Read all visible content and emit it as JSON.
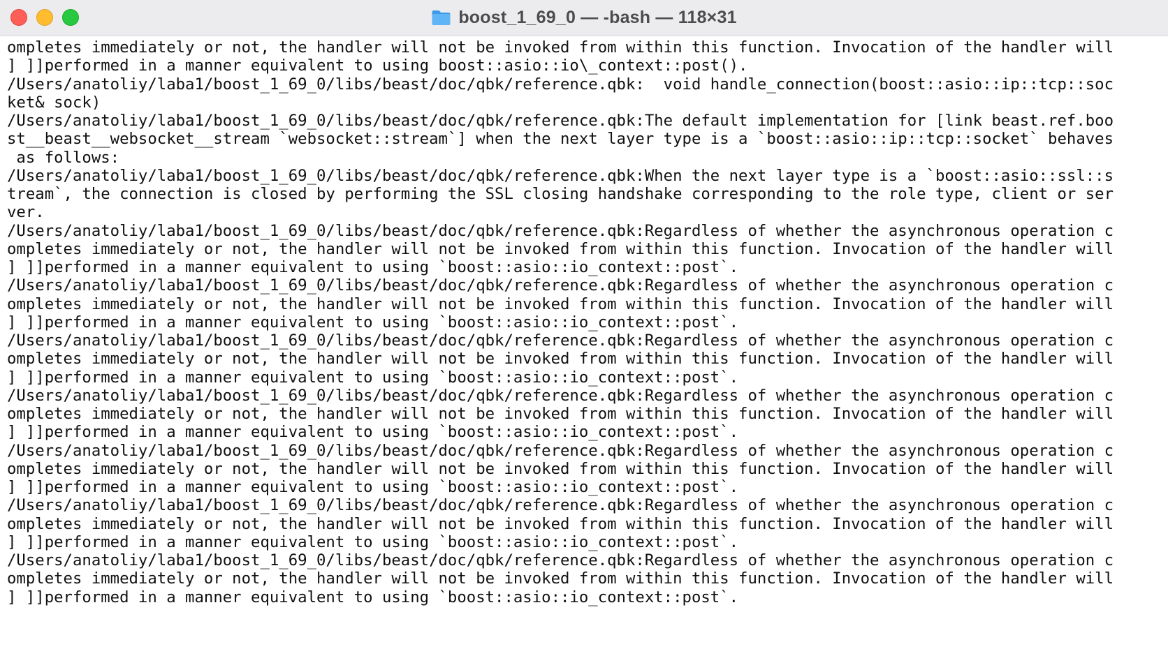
{
  "window": {
    "title": "boost_1_69_0 — -bash — 118×31",
    "folder_icon": "folder-icon",
    "colors": {
      "close": "#ff5f57",
      "minimize": "#febc2e",
      "zoom": "#28c840",
      "folder": "#4aa8f0"
    }
  },
  "terminal": {
    "lines": [
      "ompletes immediately or not, the handler will not be invoked from within this function. Invocation of the handler will",
      "] ]]performed in a manner equivalent to using boost::asio::io\\_context::post().",
      "/Users/anatoliy/laba1/boost_1_69_0/libs/beast/doc/qbk/reference.qbk:  void handle_connection(boost::asio::ip::tcp::soc",
      "ket& sock)",
      "/Users/anatoliy/laba1/boost_1_69_0/libs/beast/doc/qbk/reference.qbk:The default implementation for [link beast.ref.boo",
      "st__beast__websocket__stream `websocket::stream`] when the next layer type is a `boost::asio::ip::tcp::socket` behaves",
      " as follows:",
      "/Users/anatoliy/laba1/boost_1_69_0/libs/beast/doc/qbk/reference.qbk:When the next layer type is a `boost::asio::ssl::s",
      "tream`, the connection is closed by performing the SSL closing handshake corresponding to the role type, client or ser",
      "ver.",
      "/Users/anatoliy/laba1/boost_1_69_0/libs/beast/doc/qbk/reference.qbk:Regardless of whether the asynchronous operation c",
      "ompletes immediately or not, the handler will not be invoked from within this function. Invocation of the handler will",
      "] ]]performed in a manner equivalent to using `boost::asio::io_context::post`.",
      "/Users/anatoliy/laba1/boost_1_69_0/libs/beast/doc/qbk/reference.qbk:Regardless of whether the asynchronous operation c",
      "ompletes immediately or not, the handler will not be invoked from within this function. Invocation of the handler will",
      "] ]]performed in a manner equivalent to using `boost::asio::io_context::post`.",
      "/Users/anatoliy/laba1/boost_1_69_0/libs/beast/doc/qbk/reference.qbk:Regardless of whether the asynchronous operation c",
      "ompletes immediately or not, the handler will not be invoked from within this function. Invocation of the handler will",
      "] ]]performed in a manner equivalent to using `boost::asio::io_context::post`.",
      "/Users/anatoliy/laba1/boost_1_69_0/libs/beast/doc/qbk/reference.qbk:Regardless of whether the asynchronous operation c",
      "ompletes immediately or not, the handler will not be invoked from within this function. Invocation of the handler will",
      "] ]]performed in a manner equivalent to using `boost::asio::io_context::post`.",
      "/Users/anatoliy/laba1/boost_1_69_0/libs/beast/doc/qbk/reference.qbk:Regardless of whether the asynchronous operation c",
      "ompletes immediately or not, the handler will not be invoked from within this function. Invocation of the handler will",
      "] ]]performed in a manner equivalent to using `boost::asio::io_context::post`.",
      "/Users/anatoliy/laba1/boost_1_69_0/libs/beast/doc/qbk/reference.qbk:Regardless of whether the asynchronous operation c",
      "ompletes immediately or not, the handler will not be invoked from within this function. Invocation of the handler will",
      "] ]]performed in a manner equivalent to using `boost::asio::io_context::post`.",
      "/Users/anatoliy/laba1/boost_1_69_0/libs/beast/doc/qbk/reference.qbk:Regardless of whether the asynchronous operation c",
      "ompletes immediately or not, the handler will not be invoked from within this function. Invocation of the handler will",
      "] ]]performed in a manner equivalent to using `boost::asio::io_context::post`."
    ]
  }
}
